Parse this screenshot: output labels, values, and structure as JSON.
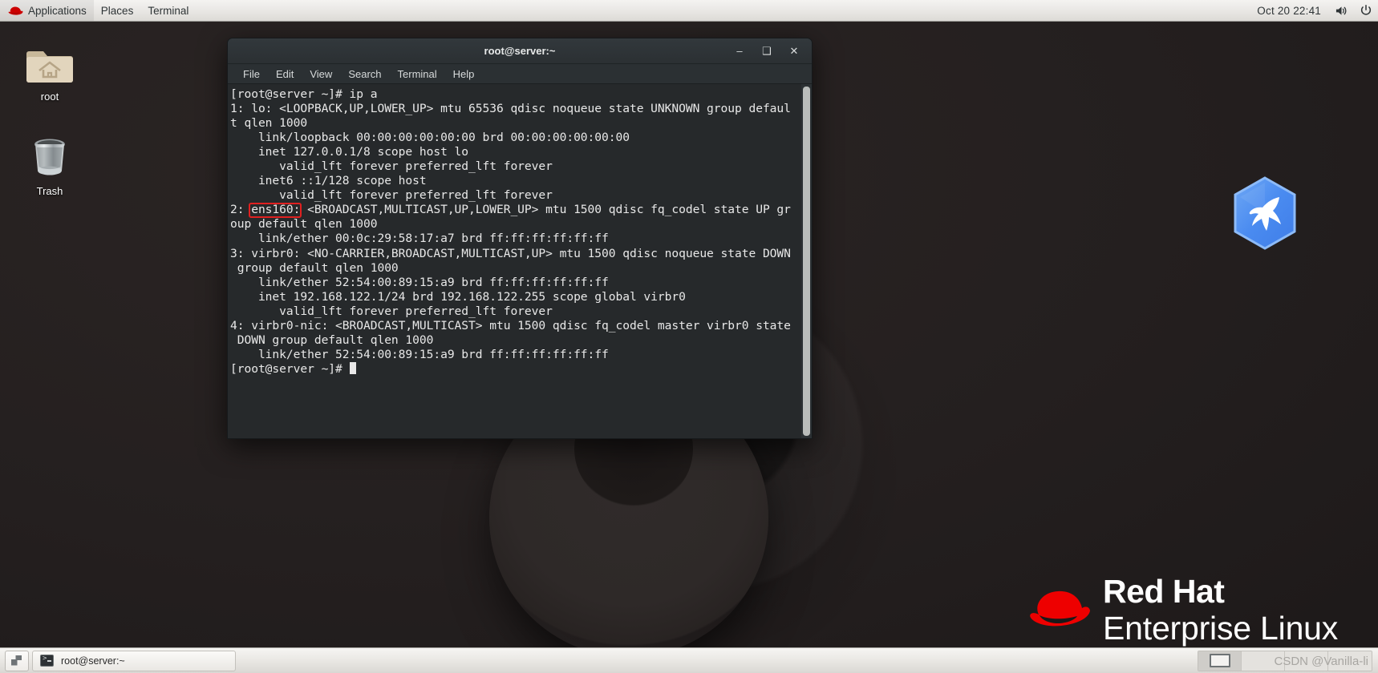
{
  "top_panel": {
    "logo_icon": "redhat-shadowman-icon",
    "menus": [
      "Applications",
      "Places",
      "Terminal"
    ],
    "clock": "Oct 20  22:41",
    "volume_icon": "volume-speaker-icon",
    "power_icon": "power-icon"
  },
  "desktop": {
    "icons": [
      {
        "label": "root",
        "icon": "home-folder-icon"
      },
      {
        "label": "Trash",
        "icon": "trash-can-icon"
      }
    ],
    "hex_logo_icon": "blue-hexagon-bird-icon",
    "branding": {
      "logo_icon": "redhat-hat-icon",
      "line1": "Red Hat",
      "line2": "Enterprise Linux"
    },
    "watermark": "CSDN @Vanilla-li"
  },
  "terminal": {
    "title": "root@server:~",
    "window_buttons": {
      "minimize": "–",
      "maximize": "❑",
      "close": "✕"
    },
    "menus": [
      "File",
      "Edit",
      "View",
      "Search",
      "Terminal",
      "Help"
    ],
    "highlight": {
      "text": "ens160:",
      "color": "#e02020"
    },
    "lines": [
      "[root@server ~]# ip a",
      "1: lo: <LOOPBACK,UP,LOWER_UP> mtu 65536 qdisc noqueue state UNKNOWN group defaul",
      "t qlen 1000",
      "    link/loopback 00:00:00:00:00:00 brd 00:00:00:00:00:00",
      "    inet 127.0.0.1/8 scope host lo",
      "       valid_lft forever preferred_lft forever",
      "    inet6 ::1/128 scope host",
      "       valid_lft forever preferred_lft forever",
      "2: ens160: <BROADCAST,MULTICAST,UP,LOWER_UP> mtu 1500 qdisc fq_codel state UP gr",
      "oup default qlen 1000",
      "    link/ether 00:0c:29:58:17:a7 brd ff:ff:ff:ff:ff:ff",
      "3: virbr0: <NO-CARRIER,BROADCAST,MULTICAST,UP> mtu 1500 qdisc noqueue state DOWN",
      " group default qlen 1000",
      "    link/ether 52:54:00:89:15:a9 brd ff:ff:ff:ff:ff:ff",
      "    inet 192.168.122.1/24 brd 192.168.122.255 scope global virbr0",
      "       valid_lft forever preferred_lft forever",
      "4: virbr0-nic: <BROADCAST,MULTICAST> mtu 1500 qdisc fq_codel master virbr0 state",
      " DOWN group default qlen 1000",
      "    link/ether 52:54:00:89:15:a9 brd ff:ff:ff:ff:ff:ff"
    ],
    "prompt": "[root@server ~]# "
  },
  "bottom_panel": {
    "show_desktop_icon": "show-desktop-icon",
    "tasks": [
      {
        "label": "root@server:~",
        "icon": "terminal-icon"
      }
    ],
    "workspaces": 4,
    "active_workspace": 1
  }
}
